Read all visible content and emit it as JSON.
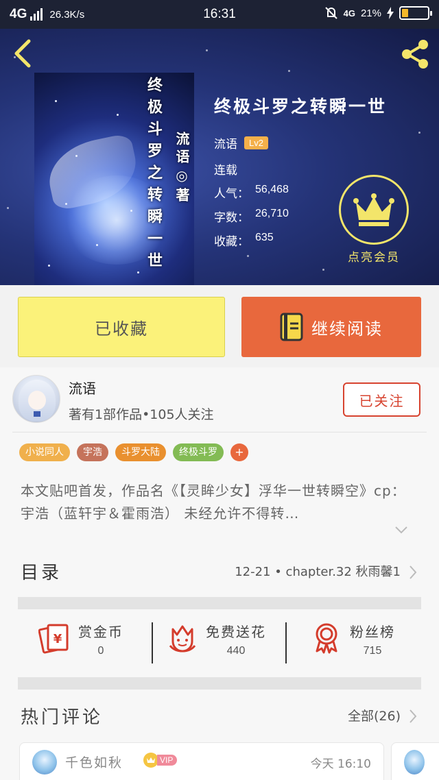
{
  "status_bar": {
    "network": "4G",
    "speed": "26.3K/s",
    "time": "16:31",
    "network_right": "4G",
    "battery": "21%"
  },
  "book": {
    "title": "终极斗罗之转瞬一世",
    "cover_title": "终极斗罗之转瞬一世",
    "cover_author": "流语◎著",
    "author": "流语",
    "author_level": "Lv2",
    "status": "连载",
    "stats": [
      {
        "label": "人气：",
        "value": "56,468"
      },
      {
        "label": "字数：",
        "value": "26,710"
      },
      {
        "label": "收藏：",
        "value": "635"
      }
    ]
  },
  "vip": {
    "label": "点亮会员"
  },
  "actions": {
    "collected": "已收藏",
    "continue_reading": "继续阅读"
  },
  "author_card": {
    "name": "流语",
    "meta": "著有1部作品•105人关注",
    "follow_label": "已关注"
  },
  "tags": [
    {
      "label": "小说同人",
      "color": "#f0b04c"
    },
    {
      "label": "宇浩",
      "color": "#c5735b"
    },
    {
      "label": "斗罗大陆",
      "color": "#e9902f"
    },
    {
      "label": "终极斗罗",
      "color": "#83bb54"
    }
  ],
  "tag_more": "+",
  "description": "本文贴吧首发，作品名《【灵眸少女】浮华一世转瞬空》cp：宇浩（蓝轩宇＆霍雨浩） 未经允许不得转…",
  "toc": {
    "title": "目录",
    "latest": "12-21 • chapter.32  秋雨馨1"
  },
  "engagement": [
    {
      "label": "赏金币",
      "value": "0",
      "icon": "red-envelope-icon"
    },
    {
      "label": "免费送花",
      "value": "440",
      "icon": "flower-icon"
    },
    {
      "label": "粉丝榜",
      "value": "715",
      "icon": "medal-icon"
    }
  ],
  "comments": {
    "title": "热门评论",
    "all_label": "全部(26)",
    "items": [
      {
        "user": "千色如秋",
        "badge": "VIP",
        "time": "今天  16:10"
      }
    ]
  },
  "colors": {
    "accent_orange": "#e8683d",
    "collected_yellow": "#fbf27a",
    "follow_red": "#d7432f",
    "vip_gold": "#f3e56a"
  }
}
